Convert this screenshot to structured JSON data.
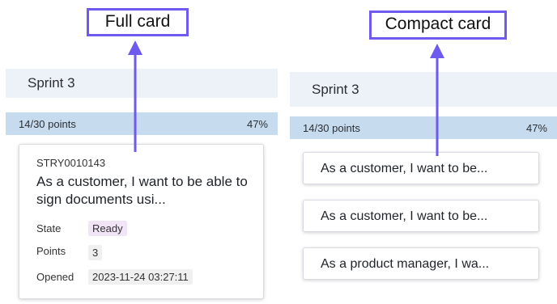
{
  "callouts": {
    "full": "Full card",
    "compact": "Compact card"
  },
  "left_panel": {
    "sprint_title": "Sprint 3",
    "points": "14/30 points",
    "percent": "47%",
    "card": {
      "number": "STRY0010143",
      "title": "As a customer, I want to be able to sign documents usi...",
      "state_label": "State",
      "state_value": "Ready",
      "points_label": "Points",
      "points_value": "3",
      "opened_label": "Opened",
      "opened_value": "2023-11-24 03:27:11"
    }
  },
  "right_panel": {
    "sprint_title": "Sprint 3",
    "points": "14/30 points",
    "percent": "47%",
    "cards": [
      {
        "title": "As a customer, I want to be..."
      },
      {
        "title": "As a customer, I want to be..."
      },
      {
        "title": "As a product manager, I wa..."
      }
    ]
  },
  "colors": {
    "callout_border": "#6f5af0",
    "sprint_header_bg": "#edf1f8",
    "points_bar_bg": "#c7dbef",
    "state_badge_bg": "#f2e4f7"
  }
}
